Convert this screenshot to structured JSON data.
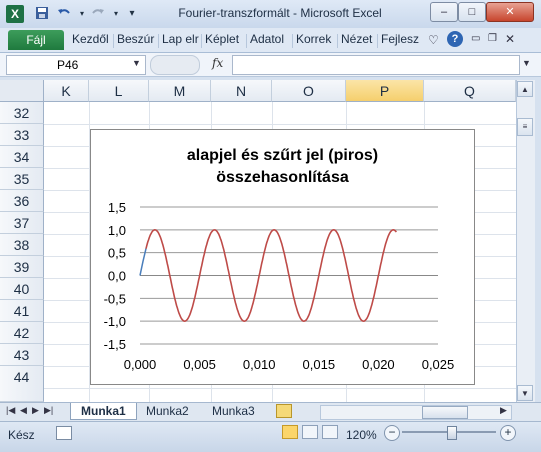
{
  "window": {
    "title": "Fourier-transzformált  -  Microsoft Excel",
    "minimize": "–",
    "maximize": "□",
    "close": "✕"
  },
  "quick_access": {
    "app_icon": "X",
    "save_icon": "save-icon",
    "undo_icon": "undo-icon",
    "redo_icon": "redo-icon"
  },
  "ribbon": {
    "file_tab": "Fájl",
    "tabs": [
      "Kezdől",
      "Beszúr",
      "Lap elr",
      "Képlet",
      "Adatol",
      "Korrek",
      "Nézet",
      "Fejlesz"
    ]
  },
  "formula_bar": {
    "name_box": "P46",
    "fx": "fx",
    "value": ""
  },
  "columns": [
    "K",
    "L",
    "M",
    "N",
    "O",
    "P",
    "Q"
  ],
  "selected_column": "P",
  "rows": [
    "32",
    "33",
    "34",
    "35",
    "36",
    "37",
    "38",
    "39",
    "40",
    "41",
    "42",
    "43",
    "44"
  ],
  "chart_data": {
    "type": "line",
    "title": "alapjel és szűrt jel (piros) összehasonlítása",
    "title_lines": [
      "alapjel és szűrt jel (piros)",
      "összehasonlítása"
    ],
    "xlim": [
      0.0,
      0.025
    ],
    "ylim": [
      -1.5,
      1.5
    ],
    "x_ticks": [
      "0,000",
      "0,005",
      "0,010",
      "0,015",
      "0,020",
      "0,025"
    ],
    "y_ticks": [
      "1,5",
      "1,0",
      "0,5",
      "0,0",
      "-0,5",
      "-1,0",
      "-1,5"
    ],
    "grid": "horizontal",
    "series": [
      {
        "color": "#4a7ebb",
        "x": [
          0.0,
          0.00025,
          0.0005
        ],
        "y": [
          0.0,
          0.31,
          0.59
        ]
      },
      {
        "color": "#be4b48",
        "frequency_hz": 200,
        "amplitude": 1.0,
        "x_start": 0.0005,
        "x_end": 0.0215
      }
    ]
  },
  "sheets": {
    "tabs": [
      "Munka1",
      "Munka2",
      "Munka3"
    ],
    "active": "Munka1"
  },
  "status": {
    "ready": "Kész",
    "zoom": "120%"
  },
  "colors": {
    "excel_green": "#1e7145",
    "accent_red": "#be4b48",
    "accent_blue": "#4a7ebb"
  }
}
